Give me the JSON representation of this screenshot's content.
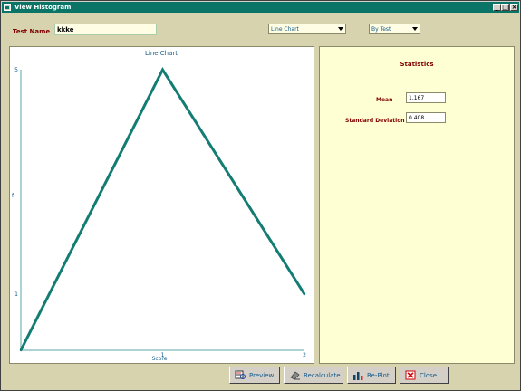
{
  "window": {
    "title": "View Histogram"
  },
  "test_name": {
    "label": "Test Name",
    "value": "kkke"
  },
  "chart_type_select": {
    "selected": "Line Chart"
  },
  "grouping_select": {
    "selected": "By Test"
  },
  "chart_data": {
    "type": "line",
    "title": "Line Chart",
    "xlabel": "Score",
    "ylabel": "",
    "x": [
      0,
      1,
      2
    ],
    "values": [
      0,
      5,
      1
    ],
    "xlim": [
      0,
      2
    ],
    "ylim": [
      0,
      5
    ],
    "x_ticks": [
      "1",
      "2"
    ],
    "y_ticks": [
      "1",
      "5"
    ],
    "y_mid_label": "f",
    "line_color": "#137c73"
  },
  "statistics": {
    "title": "Statistics",
    "mean_label": "Mean",
    "mean_value": "1.167",
    "stddev_label": "Standard Deviation",
    "stddev_value": "0.408"
  },
  "buttons": {
    "preview": "Preview",
    "recalculate": "Recalculate",
    "replot": "Re-Plot",
    "close": "Close"
  },
  "icons": {
    "app": "app-icon",
    "minimize": "minimize-icon",
    "maximize": "maximize-icon",
    "close": "close-icon",
    "preview": "print-preview-icon",
    "recalculate": "eraser-icon",
    "replot": "bar-chart-icon",
    "close_button": "x-box-icon"
  }
}
